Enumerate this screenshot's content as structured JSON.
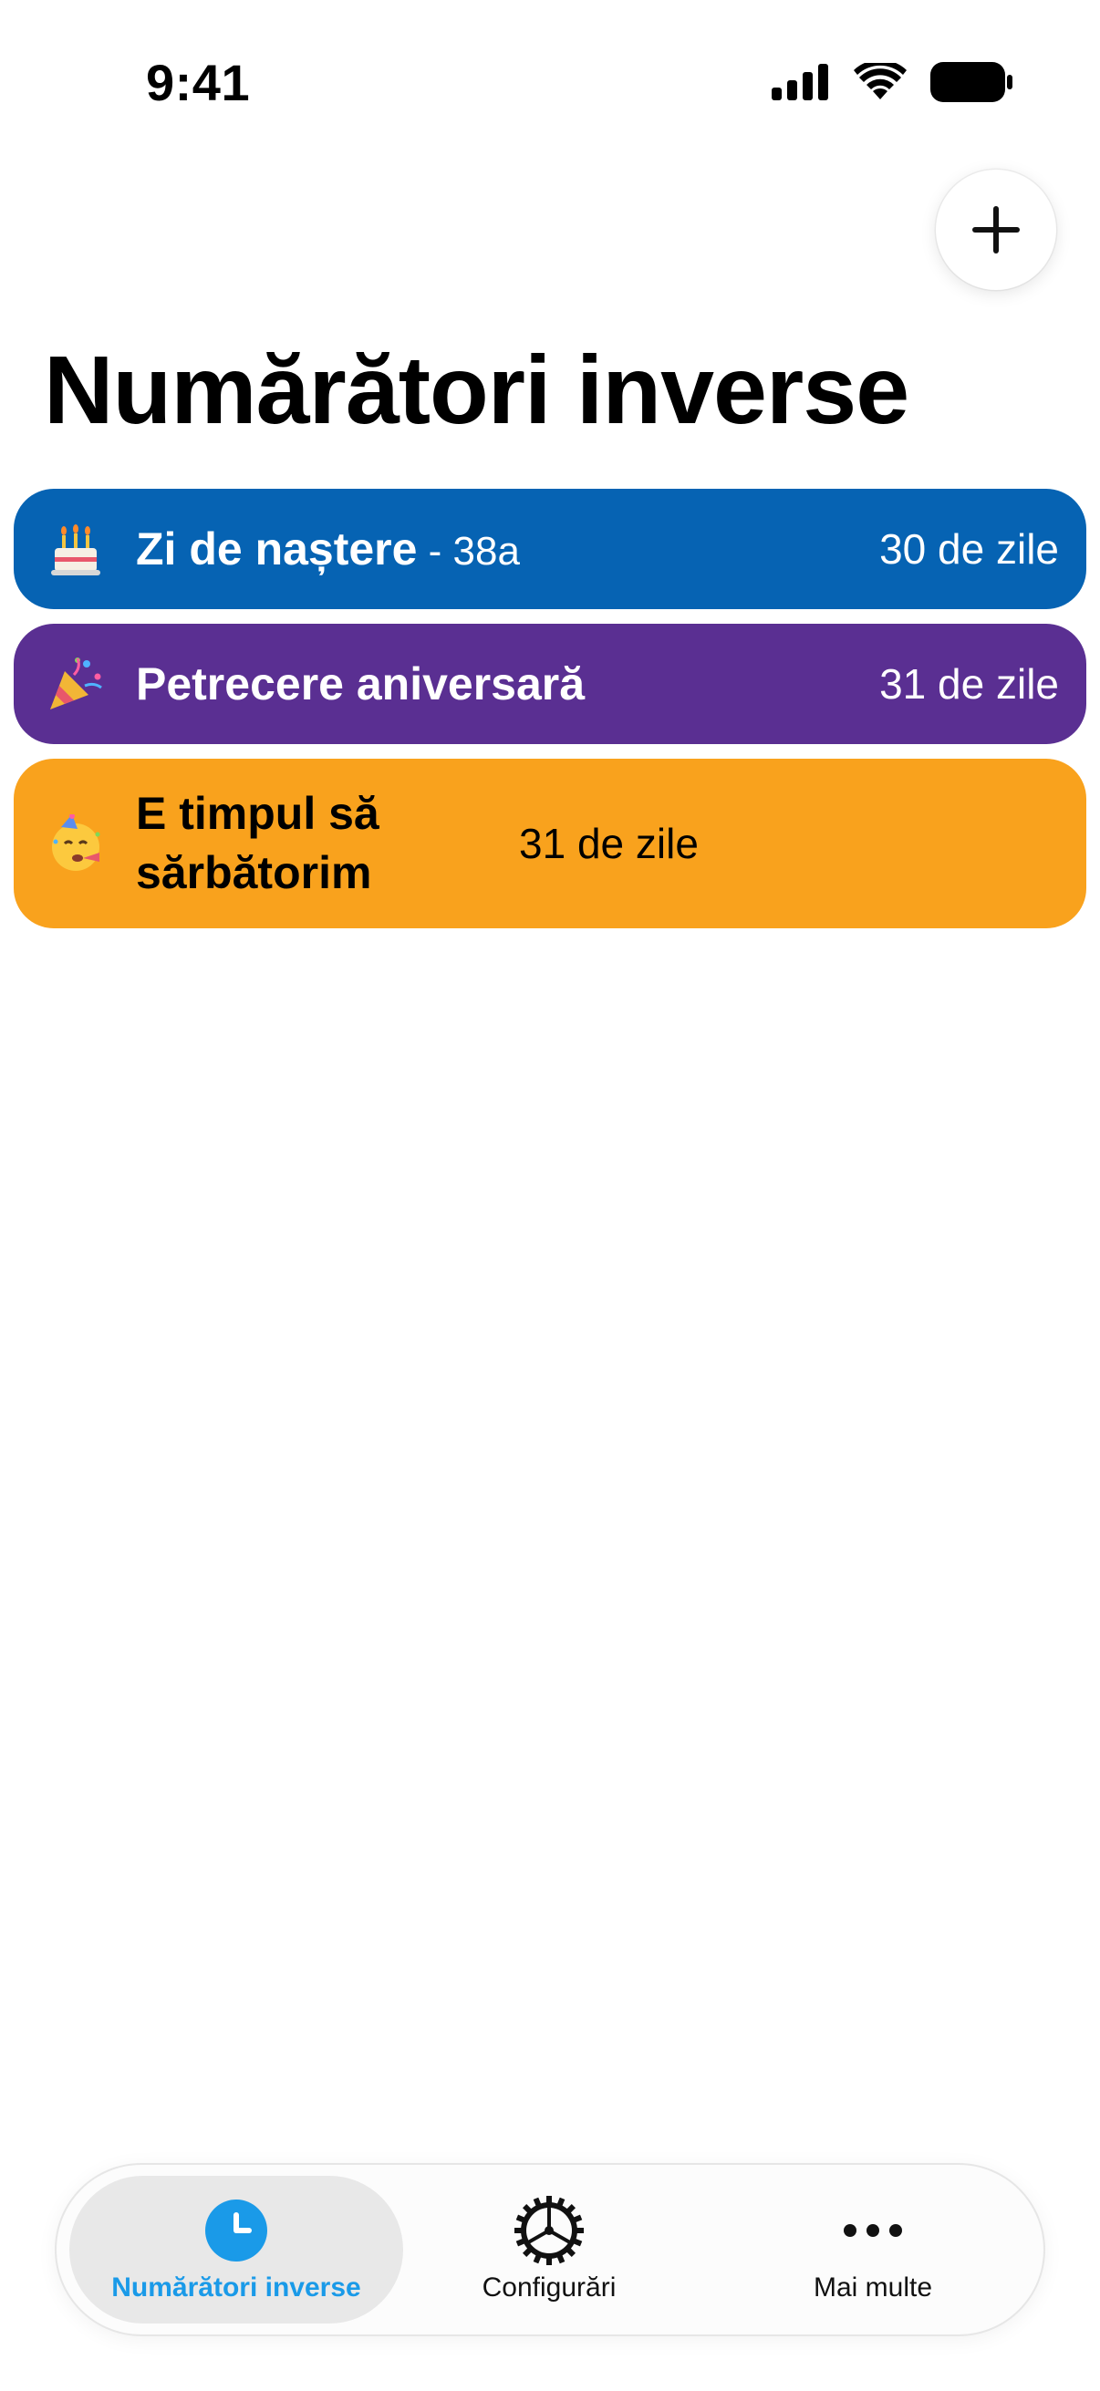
{
  "status_bar": {
    "time": "9:41"
  },
  "header": {
    "title": "Numărători inverse",
    "add_icon": "plus-icon"
  },
  "countdowns": [
    {
      "emoji": "birthday-cake-icon",
      "title": "Zi de naștere",
      "subtitle": " - 38a",
      "days": "30 de zile",
      "color": "#0663b3"
    },
    {
      "emoji": "party-popper-icon",
      "title": "Petrecere aniversară",
      "subtitle": "",
      "days": "31 de zile",
      "color": "#5a2f92"
    },
    {
      "emoji": "partying-face-icon",
      "title": "E timpul să sărbătorim",
      "subtitle": "",
      "days": "31 de zile",
      "color": "#f9a21d"
    }
  ],
  "tab_bar": {
    "tabs": [
      {
        "label": "Numărători inverse",
        "icon": "clock-icon",
        "active": true
      },
      {
        "label": "Configurări",
        "icon": "gear-icon",
        "active": false
      },
      {
        "label": "Mai multe",
        "icon": "ellipsis-icon",
        "active": false
      }
    ],
    "accent_color": "#1a9ae8"
  }
}
